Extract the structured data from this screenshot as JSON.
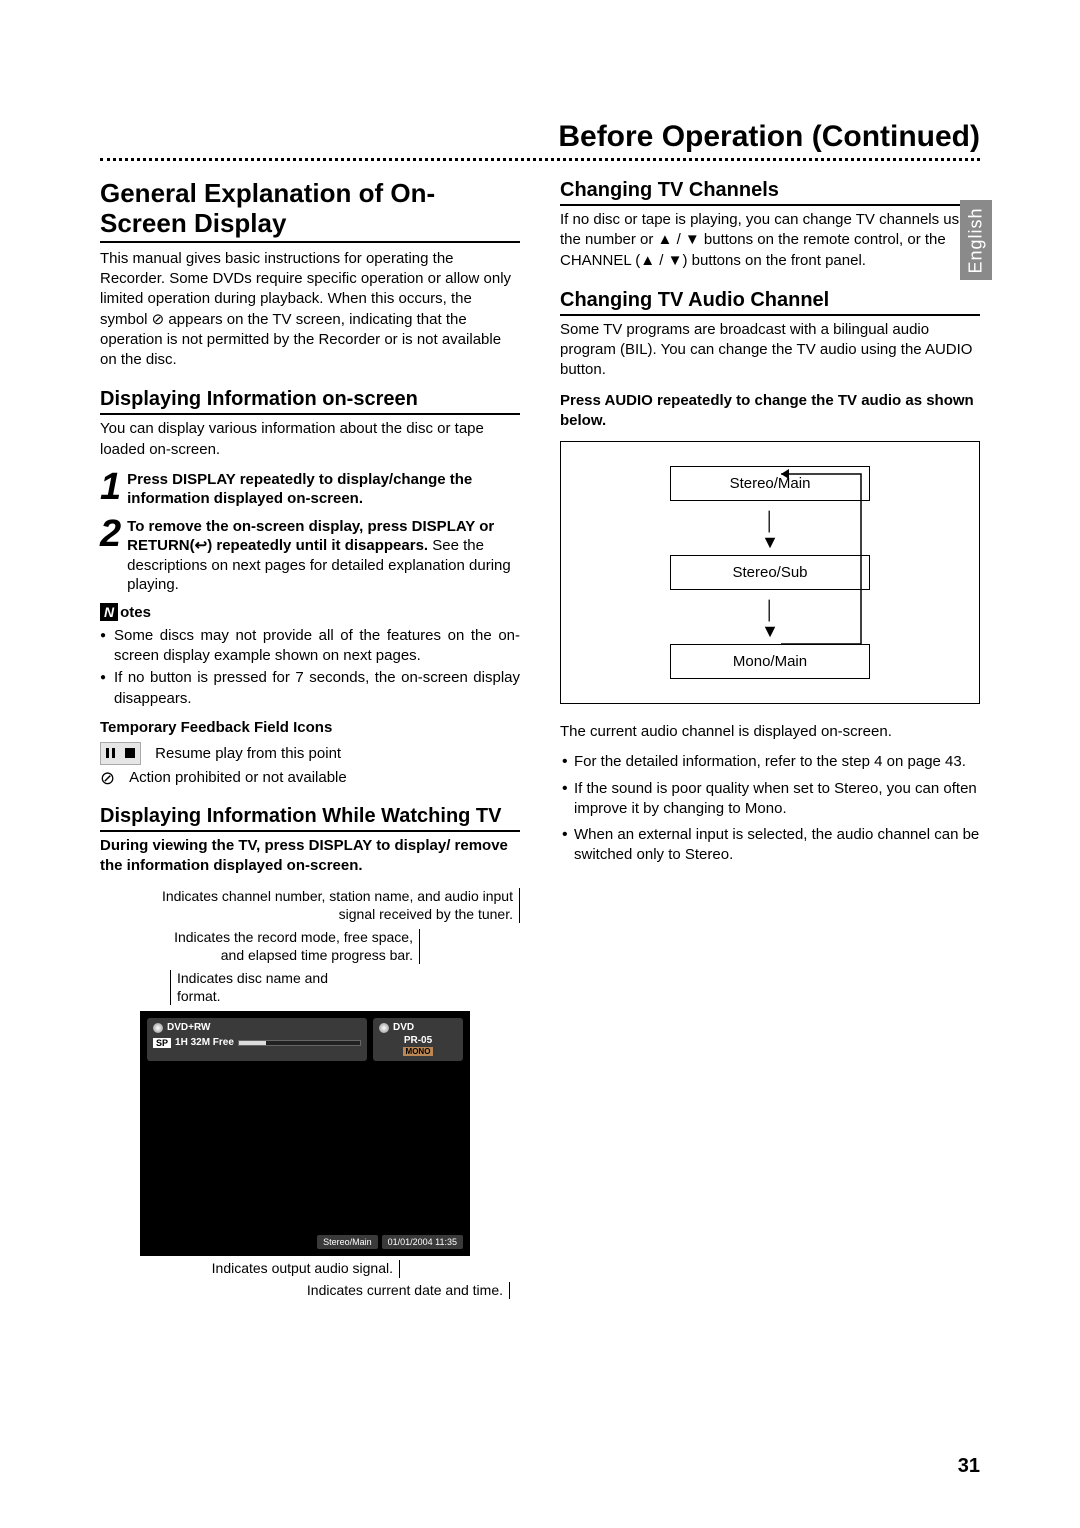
{
  "page": {
    "title": "Before Operation (Continued)",
    "language_tab": "English",
    "page_number": "31"
  },
  "left": {
    "h2": "General Explanation of On-Screen Display",
    "intro": "This manual gives basic instructions for operating the Recorder. Some DVDs require specific operation or allow only limited operation during playback. When this occurs, the symbol ⊘ appears on the TV screen, indicating that the operation is not permitted by the Recorder or is not available on the disc.",
    "h3a": "Displaying Information on-screen",
    "pa": "You can display various information about the disc or tape loaded on-screen.",
    "step1_bold": "Press DISPLAY repeatedly to display/change the information displayed on-screen.",
    "step2_bold": "To remove the on-screen display, press DISPLAY or RETURN(↩) repeatedly until it disappears.",
    "step2_tail": "See the descriptions on next pages for detailed explanation during playing.",
    "notes_label": "otes",
    "note1": "Some discs may not provide all of the features on the on-screen display example shown on next pages.",
    "note2": "If no button is pressed for 7 seconds, the on-screen display disappears.",
    "sub_temp": "Temporary Feedback Field Icons",
    "icon_resume": "Resume play from this point",
    "icon_prohibit": "Action prohibited or not available",
    "h3b": "Displaying Information While Watching TV",
    "pb_bold": "During viewing the TV, press DISPLAY to display/ remove the information displayed on-screen.",
    "callout1": "Indicates channel number, station name, and audio input signal received by the tuner.",
    "callout2": "Indicates the record mode, free space, and elapsed time progress bar.",
    "callout3": "Indicates disc name and format.",
    "osd": {
      "disc_fmt": "DVD+RW",
      "sp": "SP",
      "free": "1H 32M Free",
      "dvd": "DVD",
      "pr": "PR-05",
      "mono": "MONO",
      "audio": "Stereo/Main",
      "datetime": "01/01/2004 11:35"
    },
    "under1": "Indicates output audio signal.",
    "under2": "Indicates current date and time."
  },
  "right": {
    "h3a": "Changing TV Channels",
    "pa": "If no disc or tape is playing, you can change TV channels using the number or ▲ / ▼ buttons on the remote control, or the CHANNEL (▲ / ▼) buttons on the front panel.",
    "h3b": "Changing TV Audio Channel",
    "pb": "Some TV programs are broadcast with a bilingual audio program (BIL). You can change the TV audio using the AUDIO button.",
    "pc_bold": "Press AUDIO repeatedly to change the TV audio as shown below.",
    "flow": {
      "n1": "Stereo/Main",
      "n2": "Stereo/Sub",
      "n3": "Mono/Main"
    },
    "pd": "The current audio channel is displayed on-screen.",
    "li1": "For the detailed information, refer to the step 4 on page 43.",
    "li2": "If the sound is poor quality when set to Stereo, you can often improve it by changing to Mono.",
    "li3": "When an external input is selected, the audio channel can be switched only to Stereo."
  }
}
